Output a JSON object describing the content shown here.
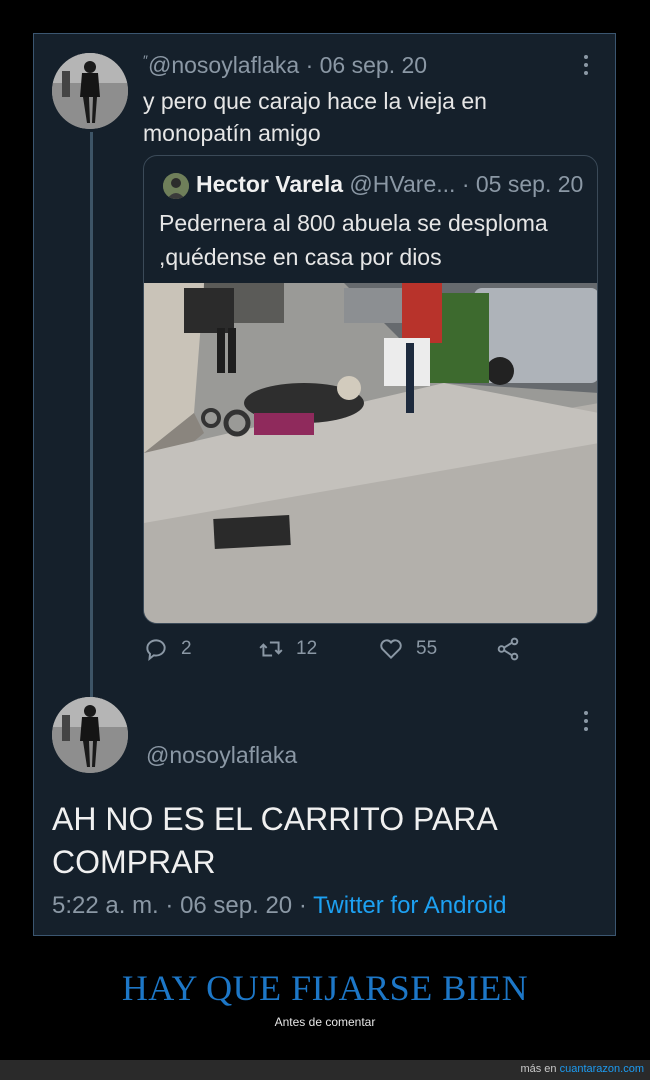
{
  "tweet": {
    "handle": "@nosoylaflaka",
    "date": "06 sep. 20",
    "text": "y pero que carajo hace la vieja en monopatín amigo",
    "quote": {
      "name": "Hector Varela",
      "handle": "@HVare...",
      "date": "05 sep. 20",
      "text": "Pedernera al 800 abuela se desploma ,quédense en casa por dios"
    },
    "actions": {
      "replies": "2",
      "retweets": "12",
      "likes": "55"
    }
  },
  "reply": {
    "handle": "@nosoylaflaka",
    "text": "AH NO ES EL CARRITO PARA COMPRAR",
    "time": "5:22 a. m.",
    "date": "06 sep. 20",
    "source": "Twitter for Android"
  },
  "caption": {
    "title": "HAY QUE FIJARSE BIEN",
    "subtitle": "Antes de comentar"
  },
  "footer": {
    "prefix": "más en",
    "site": "cuantarazon.com"
  }
}
